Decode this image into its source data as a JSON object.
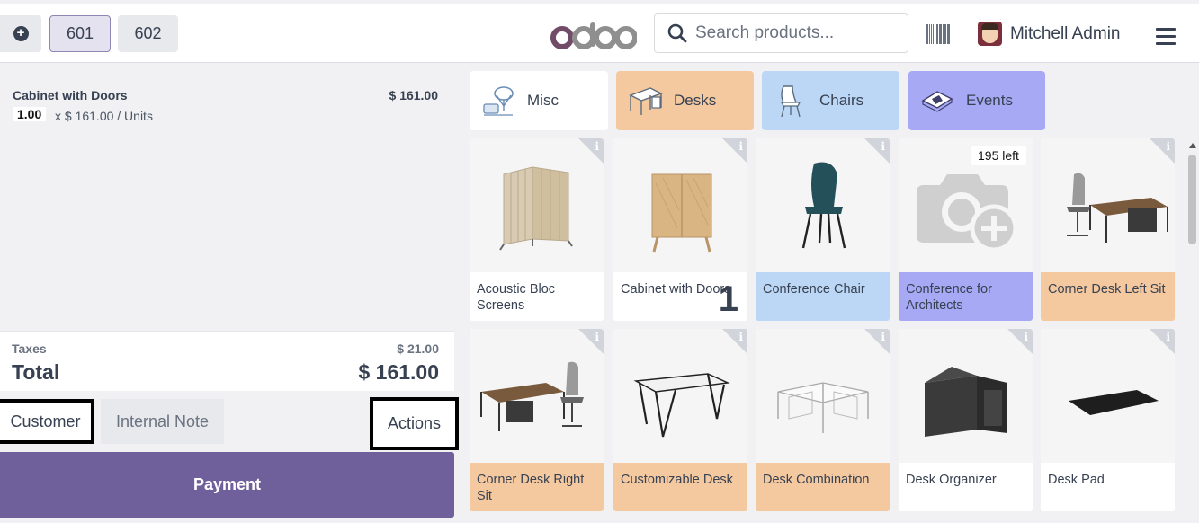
{
  "header": {
    "orders": [
      "601",
      "602"
    ],
    "logo": "odoo",
    "search_placeholder": "Search products...",
    "user_name": "Mitchell Admin"
  },
  "order": {
    "lines": [
      {
        "name": "Cabinet with Doors",
        "price": "$ 161.00",
        "qty": "1.00",
        "detail": "x $ 161.00 / Units"
      }
    ],
    "taxes_label": "Taxes",
    "taxes_value": "$ 21.00",
    "total_label": "Total",
    "total_value": "$ 161.00"
  },
  "controls": {
    "customer": "Customer",
    "internal_note": "Internal Note",
    "actions": "Actions",
    "payment": "Payment"
  },
  "categories": [
    {
      "label": "Misc",
      "color": "#ffffff"
    },
    {
      "label": "Desks",
      "color": "#f5c9a0"
    },
    {
      "label": "Chairs",
      "color": "#bcd7f5"
    },
    {
      "label": "Events",
      "color": "#a7a9f5"
    }
  ],
  "products": [
    {
      "name": "Acoustic Bloc Screens",
      "category_color": "#ffffff"
    },
    {
      "name": "Cabinet with Doors",
      "category_color": "#ffffff",
      "qty_in_cart": "1"
    },
    {
      "name": "Conference Chair",
      "category_color": "#bcd7f5"
    },
    {
      "name": "Conference for Architects",
      "category_color": "#a7a9f5",
      "badge": "195 left"
    },
    {
      "name": "Corner Desk Left Sit",
      "category_color": "#f5c9a0"
    },
    {
      "name": "Corner Desk Right Sit",
      "category_color": "#f5c9a0"
    },
    {
      "name": "Customizable Desk",
      "category_color": "#f5c9a0"
    },
    {
      "name": "Desk Combination",
      "category_color": "#f5c9a0"
    },
    {
      "name": "Desk Organizer",
      "category_color": "#ffffff"
    },
    {
      "name": "Desk Pad",
      "category_color": "#ffffff"
    }
  ],
  "colors": {
    "accent": "#714b67",
    "payment": "#6f5f9b",
    "highlight_border": "#000000"
  }
}
